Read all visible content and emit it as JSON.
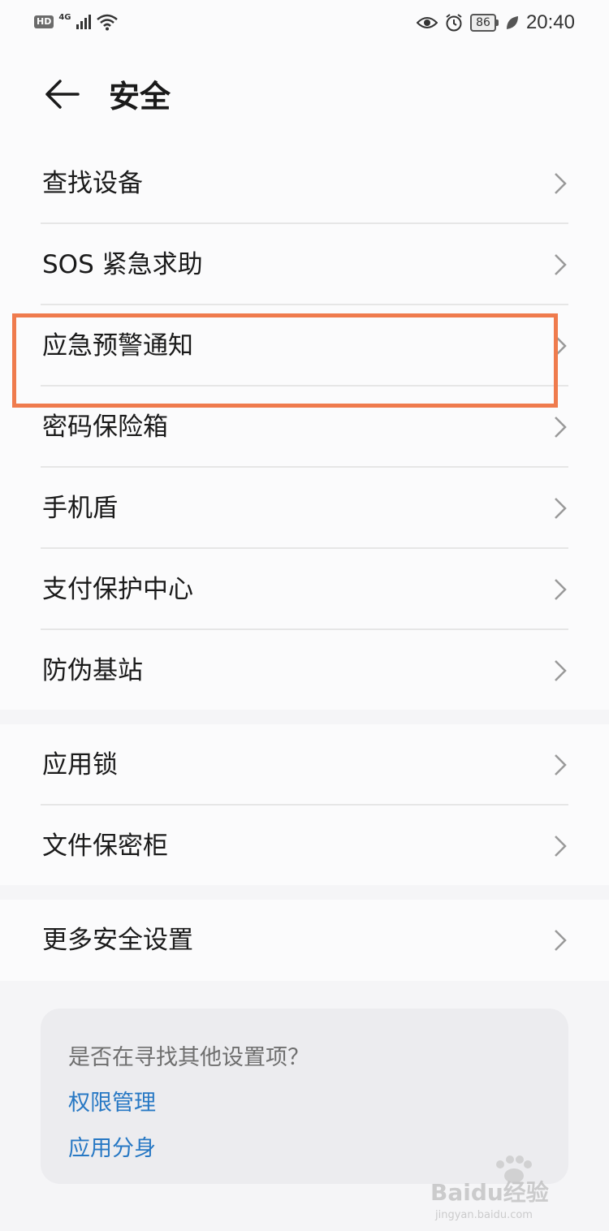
{
  "status_bar": {
    "hd": "HD",
    "network": "4G",
    "battery": "86",
    "time": "20:40"
  },
  "header": {
    "title": "安全"
  },
  "groups": [
    {
      "items": [
        {
          "label": "查找设备"
        },
        {
          "label": "SOS 紧急求助"
        },
        {
          "label": "应急预警通知"
        },
        {
          "label": "密码保险箱"
        },
        {
          "label": "手机盾"
        },
        {
          "label": "支付保护中心"
        },
        {
          "label": "防伪基站"
        }
      ]
    },
    {
      "items": [
        {
          "label": "应用锁"
        },
        {
          "label": "文件保密柜"
        }
      ]
    },
    {
      "items": [
        {
          "label": "更多安全设置"
        }
      ]
    }
  ],
  "suggestion": {
    "question": "是否在寻找其他设置项？",
    "links": [
      "权限管理",
      "应用分身"
    ]
  },
  "watermark": {
    "brand": "Baidu经验",
    "url": "jingyan.baidu.com"
  },
  "colors": {
    "highlight": "#ef7b4d",
    "link": "#2778c4",
    "background": "#f5f5f7"
  }
}
